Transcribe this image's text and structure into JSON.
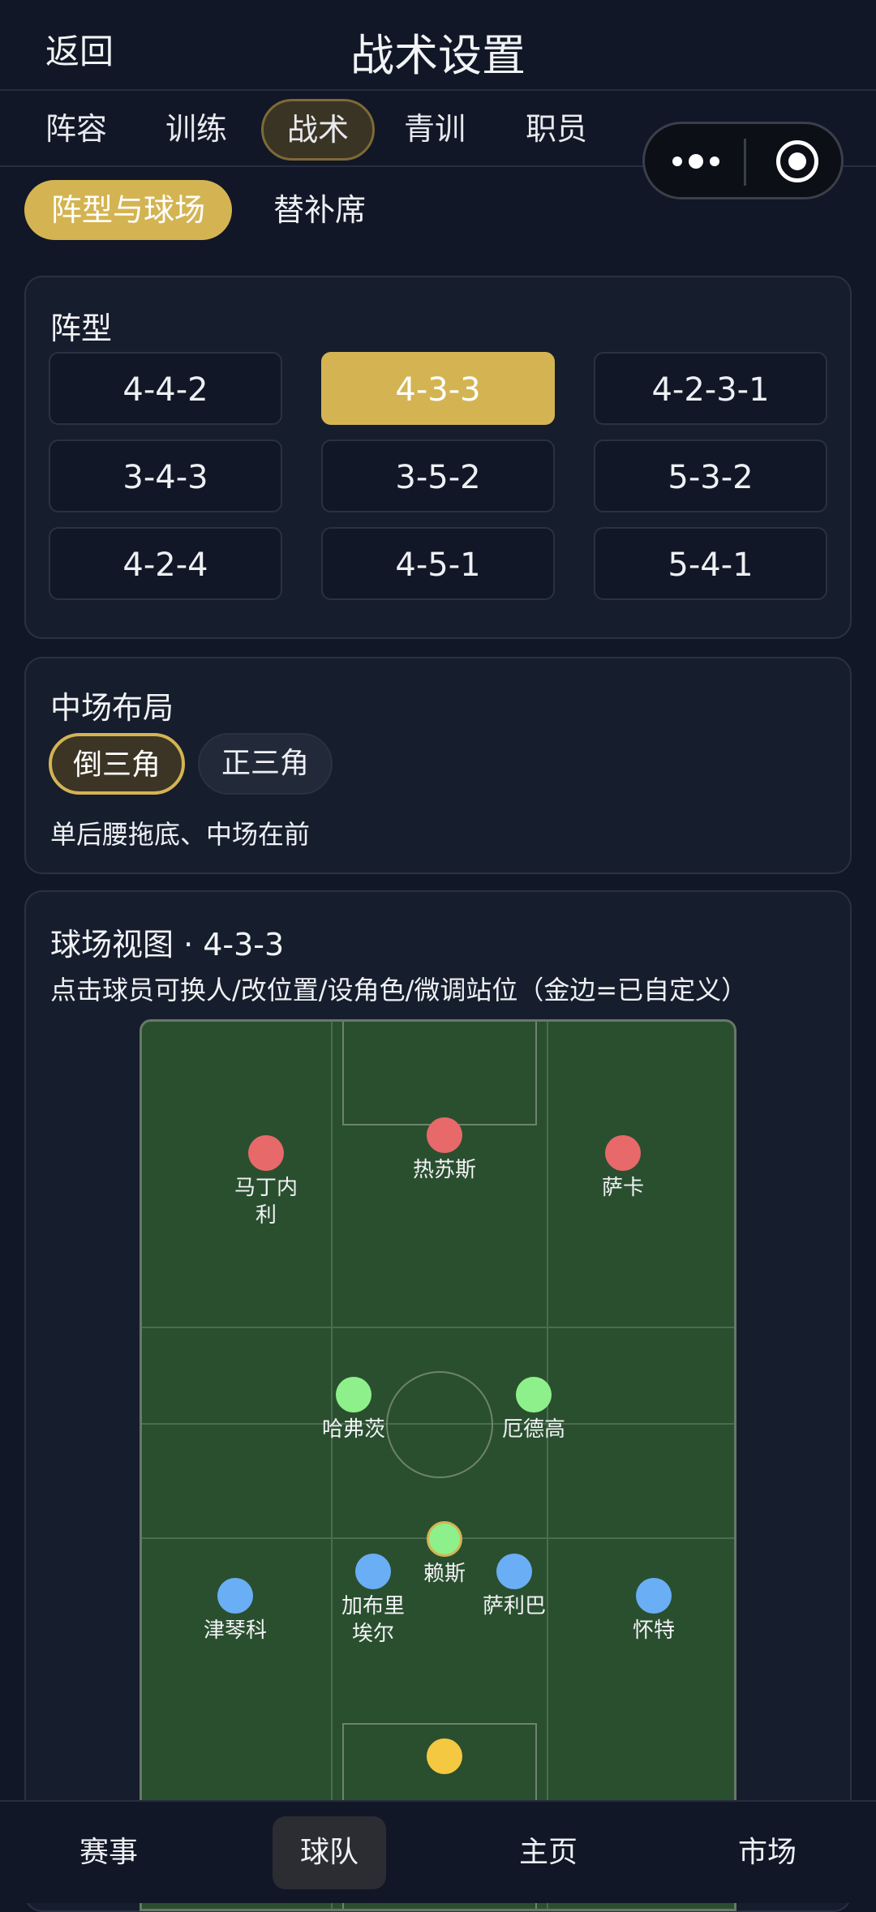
{
  "header": {
    "back_label": "返回",
    "title": "战术设置"
  },
  "tabs": [
    {
      "label": "阵容"
    },
    {
      "label": "训练"
    },
    {
      "label": "战术",
      "active": true
    },
    {
      "label": "青训"
    },
    {
      "label": "职员"
    }
  ],
  "subtabs": [
    {
      "label": "阵型与球场",
      "active": true
    },
    {
      "label": "替补席"
    }
  ],
  "formation": {
    "title": "阵型",
    "options": [
      "4-4-2",
      "4-3-3",
      "4-2-3-1",
      "3-4-3",
      "3-5-2",
      "5-3-2",
      "4-2-4",
      "4-5-1",
      "5-4-1"
    ],
    "selected": "4-3-3"
  },
  "midfield": {
    "title": "中场布局",
    "options": [
      {
        "label": "倒三角",
        "active": true
      },
      {
        "label": "正三角"
      }
    ],
    "description": "单后腰拖底、中场在前"
  },
  "pitch_view": {
    "title": "球场视图 · 4-3-3",
    "hint": "点击球员可换人/改位置/设角色/微调站位（金边=已自定义）",
    "players": [
      {
        "name": "马丁内\n利",
        "role": "forward"
      },
      {
        "name": "热苏斯",
        "role": "forward"
      },
      {
        "name": "萨卡",
        "role": "forward"
      },
      {
        "name": "哈弗茨",
        "role": "midfielder"
      },
      {
        "name": "厄德高",
        "role": "midfielder"
      },
      {
        "name": "赖斯",
        "role": "midfielder",
        "customized": true
      },
      {
        "name": "津琴科",
        "role": "defender"
      },
      {
        "name": "加布里\n埃尔",
        "role": "defender"
      },
      {
        "name": "萨利巴",
        "role": "defender"
      },
      {
        "name": "怀特",
        "role": "defender"
      },
      {
        "name": "",
        "role": "goalkeeper"
      }
    ]
  },
  "bottom_nav": [
    {
      "label": "赛事"
    },
    {
      "label": "球队",
      "active": true
    },
    {
      "label": "主页"
    },
    {
      "label": "市场"
    }
  ],
  "colors": {
    "accent": "#d4b452",
    "forward": "#e8696a",
    "midfielder": "#8ef08a",
    "defender": "#6aaef5",
    "goalkeeper": "#f5c842",
    "pitch": "#2a4f2f"
  }
}
